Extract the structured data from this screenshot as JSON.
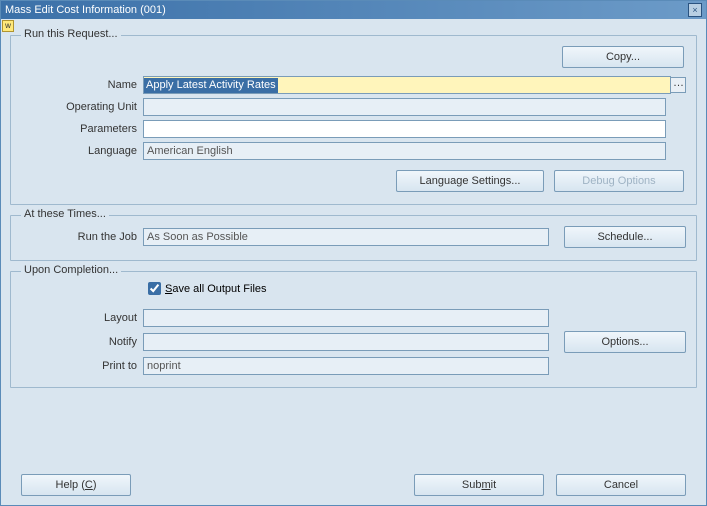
{
  "window": {
    "title": "Mass Edit Cost Information (001)",
    "close_icon": "×"
  },
  "groupRun": {
    "legend": "Run this Request...",
    "copy_label": "Copy...",
    "name_label": "Name",
    "name_value": "Apply Latest Activity Rates",
    "lov_btn": "…",
    "operating_unit_label": "Operating Unit",
    "operating_unit_value": "",
    "parameters_label": "Parameters",
    "parameters_value": "",
    "language_label": "Language",
    "language_value": "American English",
    "lang_settings_label": "Language Settings...",
    "debug_label": "Debug Options"
  },
  "groupTimes": {
    "legend": "At these Times...",
    "run_the_job_label": "Run the Job",
    "run_the_job_value": "As Soon as Possible",
    "schedule_label": "Schedule..."
  },
  "groupCompletion": {
    "legend": "Upon Completion...",
    "save_all_label_pre": "S",
    "save_all_label_rest": "ave all Output Files",
    "layout_label": "Layout",
    "layout_value": "",
    "notify_label": "Notify",
    "notify_value": "",
    "printto_label": "Print to",
    "printto_value": "noprint",
    "options_label": "Options..."
  },
  "footer": {
    "help_label_pre": "Help (",
    "help_label_u": "C",
    "help_label_post": ")",
    "submit_label_pre": "Sub",
    "submit_label_u": "m",
    "submit_label_post": "it",
    "cancel_label": "Cancel"
  }
}
